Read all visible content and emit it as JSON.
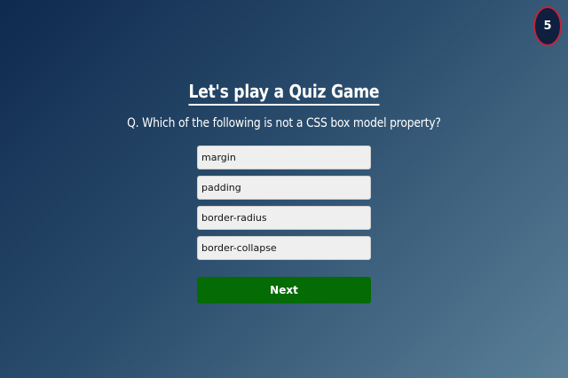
{
  "timer": {
    "value": "5"
  },
  "quiz": {
    "title": "Let's play a Quiz Game",
    "question": "Q. Which of the following is not a CSS box model property?",
    "options": [
      {
        "label": "margin"
      },
      {
        "label": "padding"
      },
      {
        "label": "border-radius"
      },
      {
        "label": "border-collapse"
      }
    ],
    "next_label": "Next"
  },
  "colors": {
    "background_start": "#0e2a4f",
    "background_end": "#5a7f97",
    "timer_border": "#c3243a",
    "next_button": "#056b05",
    "option_background": "#efefef"
  }
}
